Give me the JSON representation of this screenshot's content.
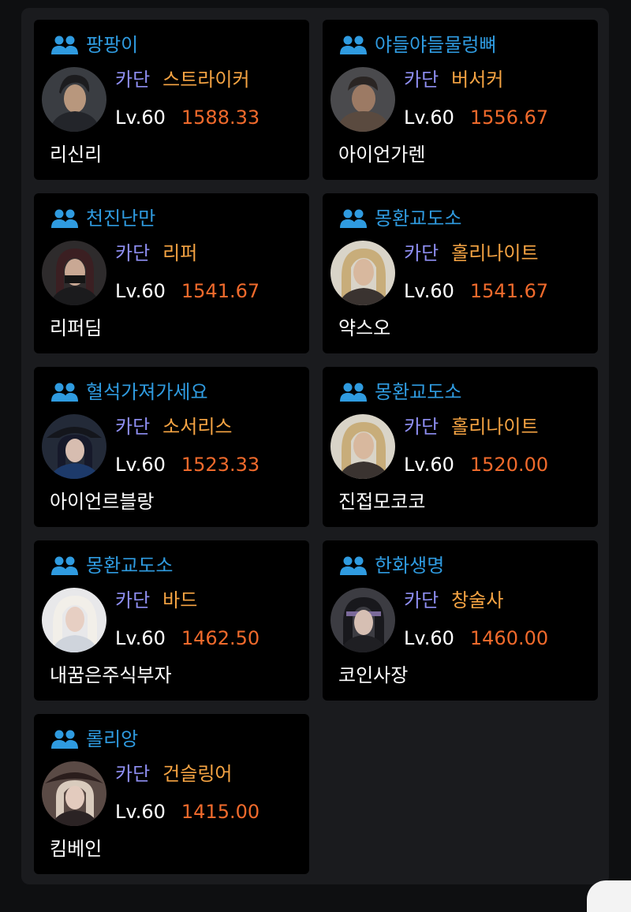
{
  "colors": {
    "background": "#0e0f11",
    "panel": "#1a1b1e",
    "card": "#000000",
    "server": "#2f9be0",
    "guild": "#8f8ff3",
    "class": "#f6a443",
    "item_level": "#f06a2c",
    "text": "#ffffff"
  },
  "cards": [
    {
      "server": "팡팡이",
      "guild": "카단",
      "class": "스트라이커",
      "level": "Lv.60",
      "item_level": "1588.33",
      "name": "리신리",
      "portrait_icon": "striker-portrait"
    },
    {
      "server": "야들야들물렁뼈",
      "guild": "카단",
      "class": "버서커",
      "level": "Lv.60",
      "item_level": "1556.67",
      "name": "아이언가렌",
      "portrait_icon": "berserker-portrait"
    },
    {
      "server": "천진난만",
      "guild": "카단",
      "class": "리퍼",
      "level": "Lv.60",
      "item_level": "1541.67",
      "name": "리퍼딤",
      "portrait_icon": "reaper-portrait"
    },
    {
      "server": "몽환교도소",
      "guild": "카단",
      "class": "홀리나이트",
      "level": "Lv.60",
      "item_level": "1541.67",
      "name": "약스오",
      "portrait_icon": "holyknight-portrait"
    },
    {
      "server": "혈석가져가세요",
      "guild": "카단",
      "class": "소서리스",
      "level": "Lv.60",
      "item_level": "1523.33",
      "name": "아이언르블랑",
      "portrait_icon": "sorceress-portrait"
    },
    {
      "server": "몽환교도소",
      "guild": "카단",
      "class": "홀리나이트",
      "level": "Lv.60",
      "item_level": "1520.00",
      "name": "진접모코코",
      "portrait_icon": "holyknight-portrait"
    },
    {
      "server": "몽환교도소",
      "guild": "카단",
      "class": "바드",
      "level": "Lv.60",
      "item_level": "1462.50",
      "name": "내꿈은주식부자",
      "portrait_icon": "bard-portrait"
    },
    {
      "server": "한화생명",
      "guild": "카단",
      "class": "창술사",
      "level": "Lv.60",
      "item_level": "1460.00",
      "name": "코인사장",
      "portrait_icon": "lancemaster-portrait"
    },
    {
      "server": "롤리앙",
      "guild": "카단",
      "class": "건슬링어",
      "level": "Lv.60",
      "item_level": "1415.00",
      "name": "킴베인",
      "portrait_icon": "gunslinger-portrait"
    }
  ]
}
